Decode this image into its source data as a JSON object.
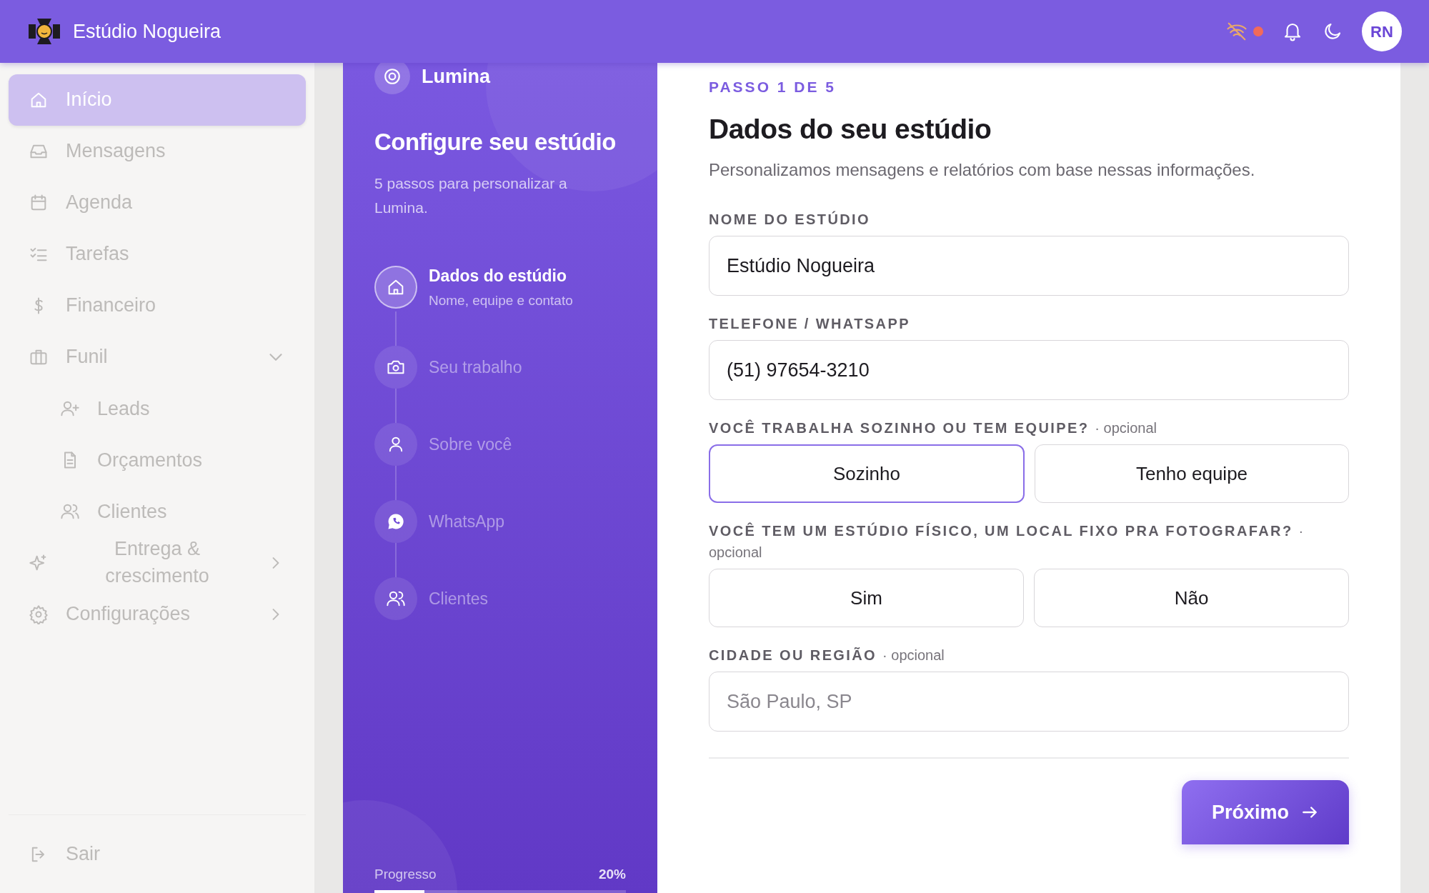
{
  "topbar": {
    "brand": "Estúdio Nogueira",
    "avatar": "RN"
  },
  "sidebar": {
    "items": [
      {
        "label": "Início",
        "selected": true
      },
      {
        "label": "Mensagens",
        "selected": false
      },
      {
        "label": "Agenda",
        "selected": false
      },
      {
        "label": "Tarefas",
        "selected": false
      },
      {
        "label": "Financeiro",
        "selected": false
      },
      {
        "label": "Funil",
        "selected": false,
        "expanded": true,
        "children": [
          {
            "label": "Leads",
            "selected": false
          },
          {
            "label": "Orçamentos",
            "selected": false
          },
          {
            "label": "Clientes",
            "selected": false
          }
        ]
      },
      {
        "label": "Entrega & crescimento",
        "selected": false,
        "expanded": false
      },
      {
        "label": "Configurações",
        "selected": false,
        "expanded": false
      }
    ],
    "footer": {
      "label": "Sair"
    }
  },
  "wizard": {
    "app": "Lumina",
    "title": "Configure seu estúdio",
    "subtitle": "5 passos para personalizar a Lumina.",
    "steps": [
      {
        "label": "Dados do estúdio",
        "hint": "Nome, equipe e contato",
        "selected": true
      },
      {
        "label": "Seu trabalho",
        "selected": false
      },
      {
        "label": "Sobre você",
        "selected": false
      },
      {
        "label": "WhatsApp",
        "selected": false
      },
      {
        "label": "Clientes",
        "selected": false
      }
    ],
    "progress_label": "Progresso",
    "progress_reading": "20%",
    "level": 0.2
  },
  "form": {
    "step": "PASSO 1 DE 5",
    "title": "Dados do seu estúdio",
    "description": "Personalizamos mensagens e relatórios com base nessas informações.",
    "fields": [
      {
        "kind": "text",
        "label": "NOME DO ESTÚDIO",
        "value": "Estúdio Nogueira"
      },
      {
        "kind": "text",
        "label": "TELEFONE / WHATSAPP",
        "value": "(51) 97654-3210"
      },
      {
        "kind": "choice",
        "label": "VOCÊ TRABALHA SOZINHO OU TEM EQUIPE?",
        "optional": "· opcional",
        "options": [
          {
            "label": "Sozinho",
            "selected": true
          },
          {
            "label": "Tenho equipe",
            "selected": false
          }
        ]
      },
      {
        "kind": "choice",
        "label": "VOCÊ TEM UM ESTÚDIO FÍSICO, UM LOCAL FIXO PRA FOTOGRAFAR?",
        "optional": "· opcional",
        "options": [
          {
            "label": "Sim",
            "selected": false
          },
          {
            "label": "Não",
            "selected": false
          }
        ]
      },
      {
        "kind": "text",
        "label": "CIDADE OU REGIÃO",
        "optional": "· opcional",
        "placeholder": "São Paulo, SP"
      }
    ],
    "next": "Próximo"
  }
}
